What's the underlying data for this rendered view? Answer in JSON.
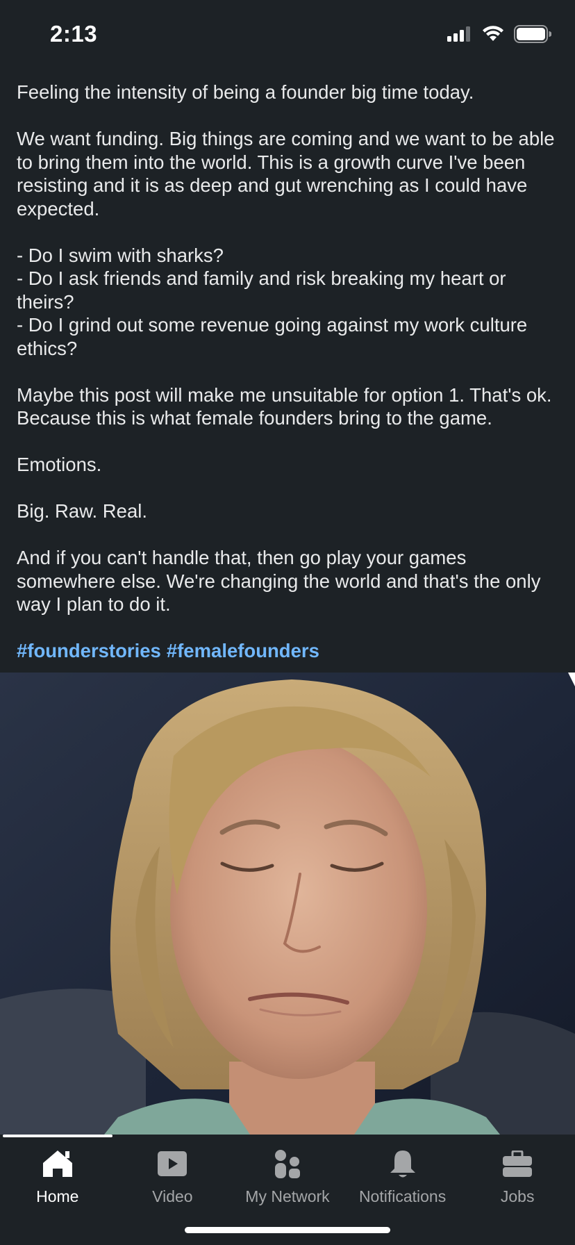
{
  "status_bar": {
    "time": "2:13",
    "icons": [
      "cellular-signal-icon",
      "wifi-icon",
      "battery-icon"
    ]
  },
  "post": {
    "paragraphs": [
      "Feeling the intensity of being a founder big time today.",
      "We want funding. Big things are coming and we want to be able to bring them into the world.  This is a growth curve I've been resisting and it is as deep and gut wrenching as I could have expected.",
      "- Do I swim with sharks?\n- Do I ask friends and family and risk breaking my heart or theirs?\n- Do I grind out some revenue going against my work culture ethics?",
      "Maybe this post will make me unsuitable for option 1. That's ok. Because this is what female founders bring to the game.",
      "Emotions.",
      "Big. Raw. Real.",
      "And if you can't handle that, then go play your games somewhere else. We're changing the world and that's the only way I plan to do it."
    ],
    "hashtags": [
      "#founderstories",
      "#femalefounders"
    ]
  },
  "bottom_nav": {
    "items": [
      {
        "label": "Home",
        "icon": "home-icon",
        "active": true
      },
      {
        "label": "Video",
        "icon": "video-icon",
        "active": false
      },
      {
        "label": "My Network",
        "icon": "my-network-icon",
        "active": false
      },
      {
        "label": "Notifications",
        "icon": "bell-icon",
        "active": false
      },
      {
        "label": "Jobs",
        "icon": "briefcase-icon",
        "active": false
      }
    ]
  },
  "colors": {
    "background": "#1d2226",
    "text": "#e9eaeb",
    "hashtag": "#71b7fb",
    "nav_inactive": "#a4a6a8",
    "nav_active": "#ffffff"
  }
}
